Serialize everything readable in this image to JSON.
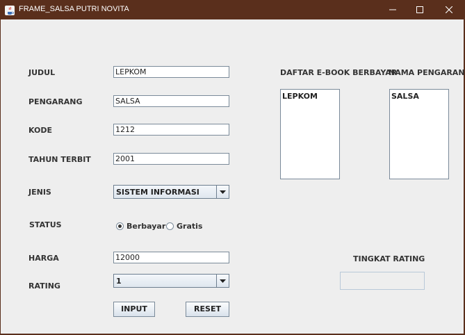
{
  "window": {
    "title": "FRAME_SALSA PUTRI NOVITA"
  },
  "form": {
    "judul": {
      "label": "JUDUL",
      "value": "LEPKOM"
    },
    "pengarang": {
      "label": "PENGARANG",
      "value": "SALSA"
    },
    "kode": {
      "label": "KODE",
      "value": "1212"
    },
    "tahun": {
      "label": "TAHUN TERBIT",
      "value": "2001"
    },
    "jenis": {
      "label": "JENIS",
      "value": "SISTEM INFORMASI"
    },
    "status": {
      "label": "STATUS",
      "option_berbayar": "Berbayar",
      "option_gratis": "Gratis",
      "selected": "Berbayar"
    },
    "harga": {
      "label": "HARGA",
      "value": "12000"
    },
    "rating": {
      "label": "RATING",
      "value": "1"
    }
  },
  "buttons": {
    "input": "INPUT",
    "reset": "RESET"
  },
  "lists": {
    "ebook": {
      "label": "DAFTAR E-BOOK BERBAYAR",
      "items": [
        "LEPKOM"
      ]
    },
    "pengarang": {
      "label": "NAMA PENGARANG",
      "items": [
        "SALSA"
      ]
    }
  },
  "tingkat_rating": {
    "label": "TINGKAT RATING",
    "value": ""
  },
  "colors": {
    "titlebar": "#5a2f1c",
    "client": "#eeeeee"
  }
}
